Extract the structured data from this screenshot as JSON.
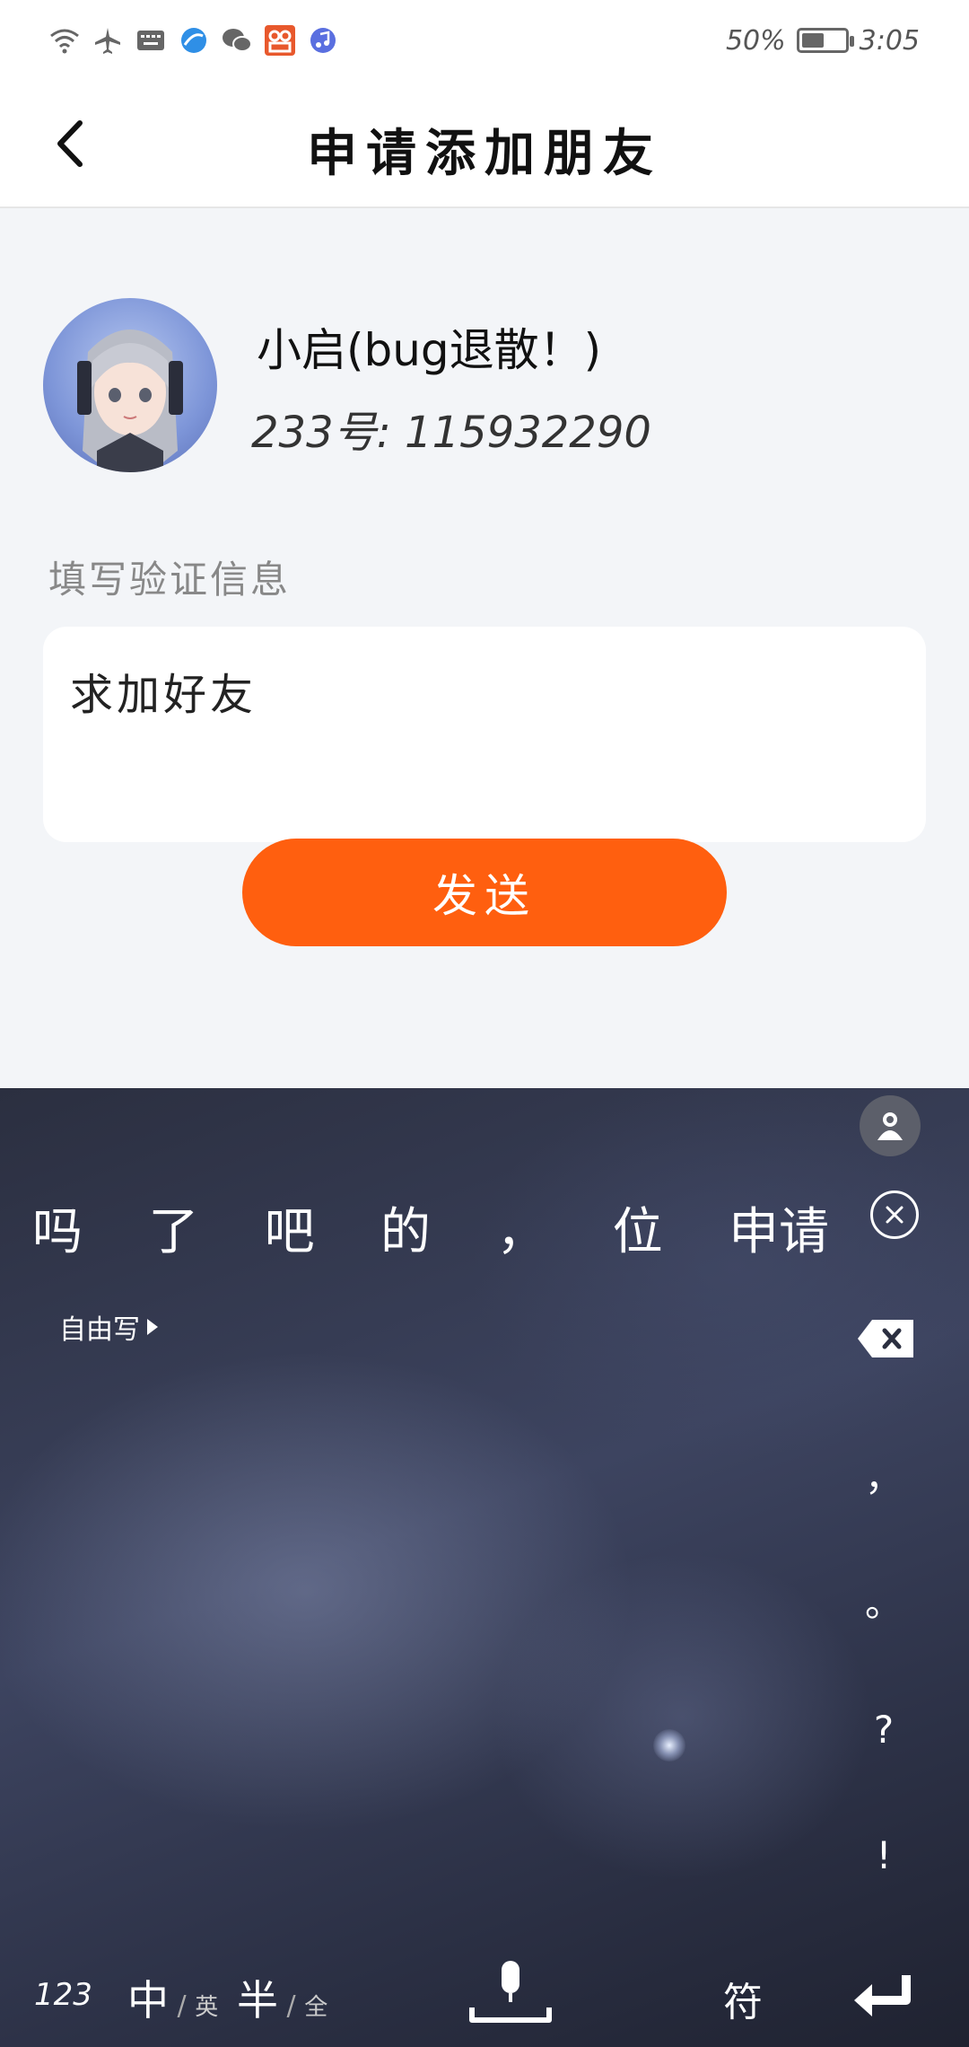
{
  "status_bar": {
    "battery_percent": "50%",
    "battery_level": 0.5,
    "time": "3:05",
    "icons": [
      "wifi-icon",
      "airplane-icon",
      "keyboard-icon",
      "browser-icon",
      "wechat-icon",
      "app-icon",
      "music-icon"
    ]
  },
  "header": {
    "title": "申请添加朋友"
  },
  "profile": {
    "nickname": "小启(bug退散！)",
    "uid": "233号: 115932290"
  },
  "verify": {
    "label": "填写验证信息",
    "message": "求加好友"
  },
  "send_button": {
    "label": "发送",
    "color": "#ff5f0f"
  },
  "keyboard": {
    "candidates": [
      "吗",
      "了",
      "吧",
      "的",
      "，",
      "位",
      "申请"
    ],
    "freewrite_label": "自由写",
    "punctuation": [
      "，",
      "。",
      "?",
      "!"
    ],
    "bottom": {
      "num_label": "123",
      "zh_main": "中",
      "zh_alt": "英",
      "half_main": "半",
      "half_alt": "全",
      "symbol_label": "符"
    }
  }
}
